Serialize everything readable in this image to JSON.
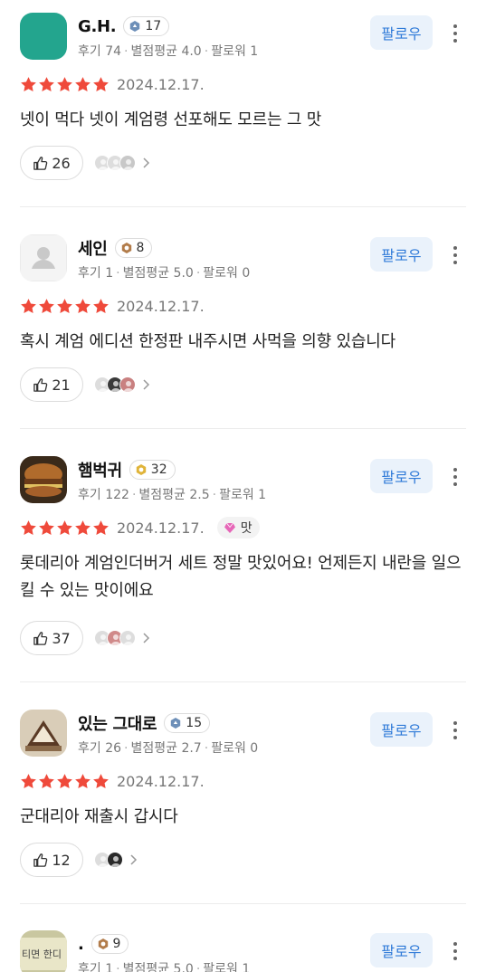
{
  "follow_label": "팔로우",
  "reviews": [
    {
      "name": "G.H.",
      "level": "17",
      "level_badge": "diamond-level-icon",
      "reviews_label": "후기 74",
      "rating_label": "별점평균 4.0",
      "followers_label": "팔로워 1",
      "date": "2024.12.17.",
      "text": "넷이 먹다 넷이 계엄령 선포해도 모르는 그 맛",
      "likes": "26",
      "avatar": "teal-square"
    },
    {
      "name": "세인",
      "level": "8",
      "level_badge": "bronze-level-icon",
      "reviews_label": "후기 1",
      "rating_label": "별점평균 5.0",
      "followers_label": "팔로워 0",
      "date": "2024.12.17.",
      "text": "혹시 계엄 에디션 한정판 내주시면 사먹을 의향 있습니다",
      "likes": "21",
      "avatar": "default-person"
    },
    {
      "name": "햄벅귀",
      "level": "32",
      "level_badge": "gold-level-icon",
      "reviews_label": "후기 122",
      "rating_label": "별점평균 2.5",
      "followers_label": "팔로워 1",
      "date": "2024.12.17.",
      "tag": "맛",
      "text": "롯데리아 계엄인더버거 세트 정말 맛있어요! 언제든지 내란을 일으킬 수 있는 맛이에요",
      "likes": "37",
      "avatar": "burger-photo"
    },
    {
      "name": "있는 그대로",
      "level": "15",
      "level_badge": "diamond-level-icon",
      "reviews_label": "후기 26",
      "rating_label": "별점평균 2.7",
      "followers_label": "팔로워 0",
      "date": "2024.12.17.",
      "text": "군대리아 재출시 갑시다",
      "likes": "12",
      "avatar": "food-photo"
    },
    {
      "name": ".",
      "level": "9",
      "level_badge": "bronze-level-icon",
      "reviews_label": "후기 1",
      "rating_label": "별점평균 5.0",
      "followers_label": "팔로워 1",
      "avatar_text": "티면 한디",
      "avatar": "sign-photo"
    }
  ],
  "colors": {
    "star": "#ef4a3b",
    "follow_bg": "#eaf2fb",
    "follow_text": "#2f7ad8",
    "teal_avatar": "#23a58e"
  }
}
